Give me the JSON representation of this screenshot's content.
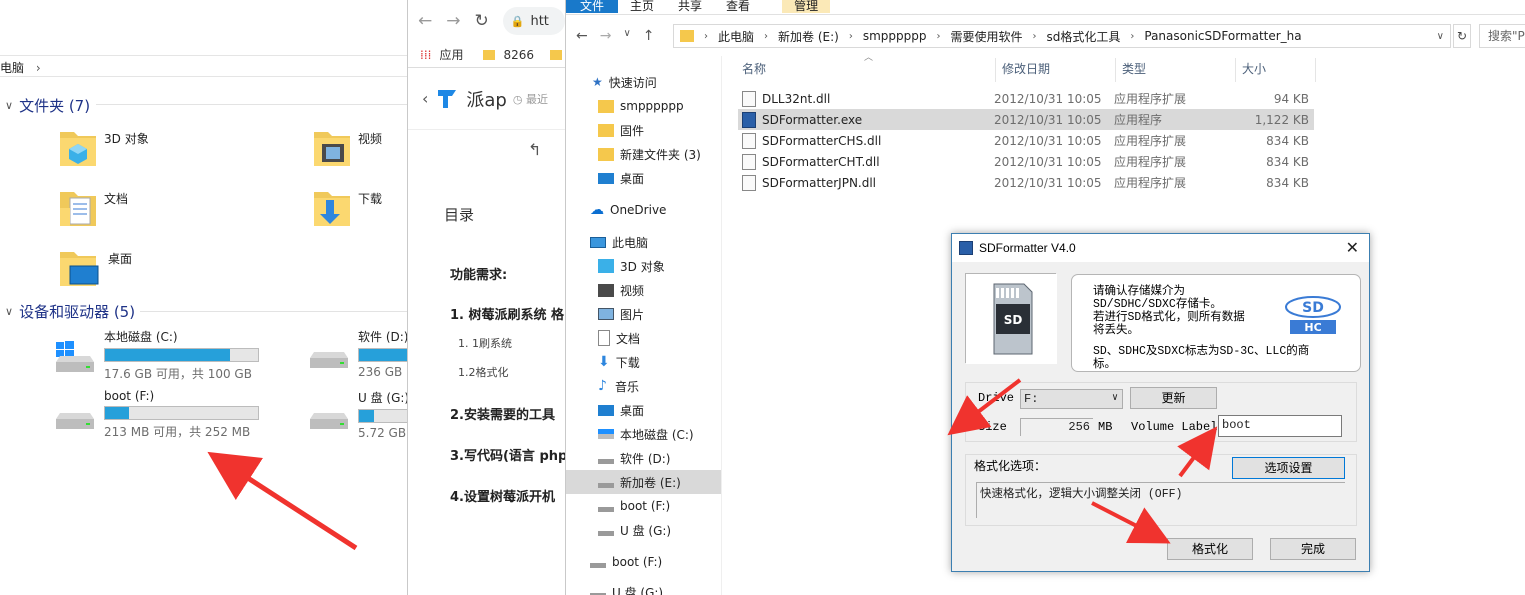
{
  "thispc": {
    "crumb": "电脑",
    "folders_header": "文件夹 (7)",
    "folders": [
      {
        "label": "3D 对象",
        "icon": "3d-objects-folder-icon"
      },
      {
        "label": "视频",
        "icon": "video-folder-icon"
      },
      {
        "label": "文档",
        "icon": "documents-folder-icon"
      },
      {
        "label": "下载",
        "icon": "downloads-folder-icon"
      },
      {
        "label": "桌面",
        "icon": "desktop-folder-icon"
      }
    ],
    "devices_header": "设备和驱动器 (5)",
    "drives": [
      {
        "name": "本地磁盘 (C:)",
        "free": "17.6 GB 可用，共 100 GB",
        "used_fraction": 0.82
      },
      {
        "name": "软件 (D:)",
        "free": "236 GB",
        "used_fraction": 0.5
      },
      {
        "name": "boot (F:)",
        "free": "213 MB 可用，共 252 MB",
        "used_fraction": 0.16
      },
      {
        "name": "U 盘 (G:)",
        "free": "5.72 GB",
        "used_fraction": 0.1
      }
    ]
  },
  "browser": {
    "url": "htt",
    "bookmarks": [
      "应用",
      "8266"
    ],
    "site_name": "派ap",
    "recent": "最近",
    "toc_title": "目录",
    "toc": [
      {
        "text": "功能需求:",
        "level": 0
      },
      {
        "text": "1. 树莓派刷系统 格",
        "level": 0
      },
      {
        "text": "1. 1刷系统",
        "level": 1
      },
      {
        "text": "1.2格式化",
        "level": 1
      },
      {
        "text": "2.安装需要的工具",
        "level": 0
      },
      {
        "text": "3.写代码(语言 php",
        "level": 0
      },
      {
        "text": "4.设置树莓派开机",
        "level": 0
      }
    ]
  },
  "explorer": {
    "ribbon": [
      "文件",
      "主页",
      "共享",
      "查看",
      "管理"
    ],
    "path": [
      "此电脑",
      "新加卷 (E:)",
      "smpppppp",
      "需要使用软件",
      "sd格式化工具",
      "PanasonicSDFormatter_ha"
    ],
    "search_placeholder": "搜索\"P",
    "nav": [
      {
        "label": "快速访问",
        "icon": "star-icon"
      },
      {
        "label": "smpppppp",
        "icon": "folder-icon"
      },
      {
        "label": "固件",
        "icon": "folder-icon"
      },
      {
        "label": "新建文件夹 (3)",
        "icon": "folder-icon"
      },
      {
        "label": "桌面",
        "icon": "desktop-icon"
      },
      {
        "label": "OneDrive",
        "icon": "cloud-icon"
      },
      {
        "label": "此电脑",
        "icon": "computer-icon"
      },
      {
        "label": "3D 对象",
        "icon": "cube-icon"
      },
      {
        "label": "视频",
        "icon": "video-icon"
      },
      {
        "label": "图片",
        "icon": "picture-icon"
      },
      {
        "label": "文档",
        "icon": "document-icon"
      },
      {
        "label": "下载",
        "icon": "download-icon"
      },
      {
        "label": "音乐",
        "icon": "music-icon"
      },
      {
        "label": "桌面",
        "icon": "desktop-icon"
      },
      {
        "label": "本地磁盘 (C:)",
        "icon": "drive-c-icon"
      },
      {
        "label": "软件 (D:)",
        "icon": "drive-icon"
      },
      {
        "label": "新加卷 (E:)",
        "icon": "drive-icon"
      },
      {
        "label": "boot (F:)",
        "icon": "drive-icon"
      },
      {
        "label": "U 盘 (G:)",
        "icon": "drive-icon"
      },
      {
        "label": "boot (F:)",
        "icon": "drive-icon"
      },
      {
        "label": "U 盘 (G:)",
        "icon": "drive-icon"
      }
    ],
    "columns": [
      "名称",
      "修改日期",
      "类型",
      "大小"
    ],
    "files": [
      {
        "name": "DLL32nt.dll",
        "date": "2012/10/31 10:05",
        "type": "应用程序扩展",
        "size": "94 KB",
        "kind": "dll"
      },
      {
        "name": "SDFormatter.exe",
        "date": "2012/10/31 10:05",
        "type": "应用程序",
        "size": "1,122 KB",
        "kind": "exe"
      },
      {
        "name": "SDFormatterCHS.dll",
        "date": "2012/10/31 10:05",
        "type": "应用程序扩展",
        "size": "834 KB",
        "kind": "dll"
      },
      {
        "name": "SDFormatterCHT.dll",
        "date": "2012/10/31 10:05",
        "type": "应用程序扩展",
        "size": "834 KB",
        "kind": "dll"
      },
      {
        "name": "SDFormatterJPN.dll",
        "date": "2012/10/31 10:05",
        "type": "应用程序扩展",
        "size": "834 KB",
        "kind": "dll"
      }
    ]
  },
  "dialog": {
    "title": "SDFormatter V4.0",
    "info_line1": "请确认存储媒介为",
    "info_line2": "SD/SDHC/SDXC存储卡。",
    "info_line3": "若进行SD格式化，则所有数据",
    "info_line4": "将丢失。",
    "info_line5": "SD、SDHC及SDXC标志为SD-3C、LLC的商",
    "info_line6": "标。",
    "drive_label": "Drive",
    "drive_value": "F:",
    "refresh_button": "更新",
    "size_label": "Size",
    "size_value": "256",
    "size_unit": "MB",
    "volume_label": "Volume Label",
    "volume_value": "boot",
    "options_label": "格式化选项：",
    "options_button": "选项设置",
    "options_value": "快速格式化，逻辑大小调整关闭 (OFF)",
    "format_button": "格式化",
    "done_button": "完成"
  },
  "colors": {
    "accent": "#1979ca",
    "drive_bar": "#26a0da",
    "selection": "#cce8ff",
    "arrow": "#f0332e",
    "section_header": "#1e3287"
  }
}
